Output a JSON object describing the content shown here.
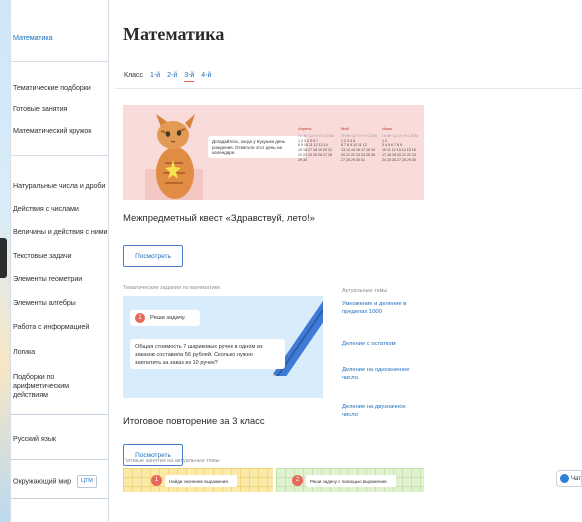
{
  "sidebar": {
    "active_item": "Математика",
    "group1": [
      "Тематические подборки",
      "Готовые занятия",
      "Математический кружок"
    ],
    "group2": [
      "Натуральные числа и дроби",
      "Действия с числами",
      "Величины и действия с ними",
      "Текстовые задачи",
      "Элементы геометрии",
      "Элементы алгебры",
      "Работа с информацией",
      "Логика",
      "Подборки по арифметическим действиям"
    ],
    "russian": "Русский язык",
    "world": "Окружающий мир",
    "world_badge": "ЦТМ"
  },
  "main": {
    "title": "Математика",
    "class_label": "Класс",
    "classes": [
      "1-й",
      "2-й",
      "3-й",
      "4-й"
    ],
    "active_class": "3-й"
  },
  "quest": {
    "speech": "Догадайтесь, когда у Кукушки день рождения. Отметьте этот день на календаре.",
    "months": [
      {
        "name": "Апрель",
        "weekdays": "Пн Вт Ср Чт Пт Сб Вс",
        "rows": [
          "1 2 3 4 5 6 7",
          "8 9 10 11 12 13 14",
          "15 16 17 18 19 20 21",
          "22 23 24 25 26 27 28",
          "29 30"
        ]
      },
      {
        "name": "Май",
        "weekdays": "Пн Вт Ср Чт Пт Сб Вс",
        "rows": [
          "1 2 3 4 5",
          "6 7 8 9 10 11 12",
          "13 14 15 16 17 18 19",
          "20 21 22 23 24 25 26",
          "27 28 29 30 31"
        ]
      },
      {
        "name": "Июнь",
        "weekdays": "Пн Вт Ср Чт Пт Сб Вс",
        "rows": [
          "1 2",
          "3 4 5 6 7 8 9",
          "10 11 12 13 14 15 16",
          "17 18 19 20 21 22 23",
          "24 25 26 27 28 29 30"
        ]
      }
    ],
    "title": "Межпредметный квест «Здравствуй, лето!»",
    "button": "Посмотреть"
  },
  "thematic": {
    "label": "Тематические задания по математике",
    "chip": "Реши задачу.",
    "task": "Общая стоимость 7 шариковых ручек в одном из заказов составила 56 рублей. Сколько нужно заплатить за заказ из 10 ручек?",
    "title": "Итоговое повторение за 3 класс",
    "button": "Посмотреть"
  },
  "topics": {
    "label": "Актуальные темы",
    "items": [
      "Умножение и деление в пределах 1000",
      "Деление с остатком",
      "Деление на однозначное число.",
      "Деление на двузначное число"
    ]
  },
  "ready": {
    "label": "Готовые занятия на актуальные темы",
    "card1": "Найди значение выражения.",
    "card2": "Реши задачу с помощью выражения."
  },
  "chat": {
    "label": "Чат"
  }
}
